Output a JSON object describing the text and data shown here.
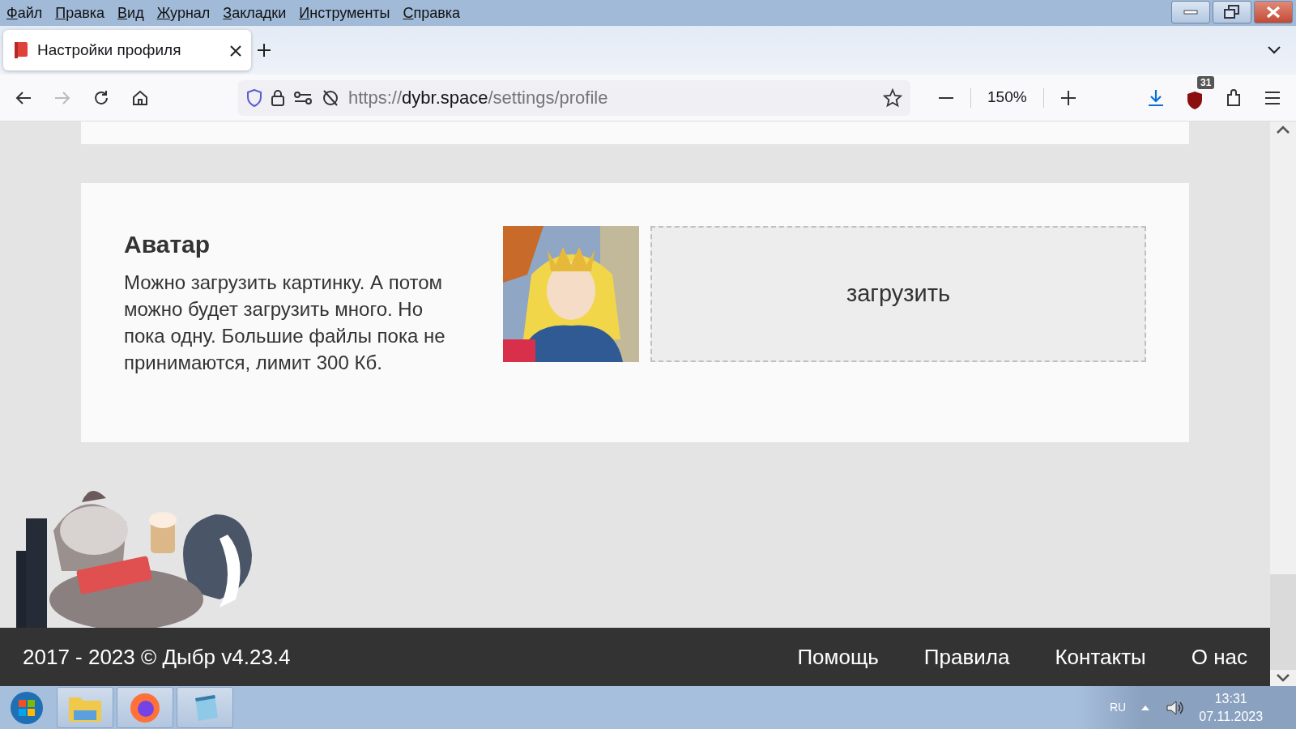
{
  "menu_bar": [
    "Файл",
    "Правка",
    "Вид",
    "Журнал",
    "Закладки",
    "Инструменты",
    "Справка"
  ],
  "tabs": [
    {
      "title": "Настройки профиля",
      "selected": true
    }
  ],
  "toolbar": {
    "forward_disabled": true,
    "url": {
      "scheme": "https://",
      "host": "dybr.space",
      "path": "/settings/profile"
    },
    "zoom": "150%",
    "extension_badge": "31"
  },
  "avatar_section": {
    "heading": "Аватар",
    "description": "Можно загрузить картинку. А потом можно будет загрузить много. Но пока одну. Большие файлы пока не принимаются, лимит 300 Кб.",
    "upload_label": "загрузить"
  },
  "footer": {
    "copyright": "2017 - 2023 © Дыбр v4.23.4",
    "links": [
      "Помощь",
      "Правила",
      "Контакты",
      "О нас"
    ]
  },
  "taskbar": {
    "language": "RU",
    "time": "13:31",
    "date": "07.11.2023"
  }
}
